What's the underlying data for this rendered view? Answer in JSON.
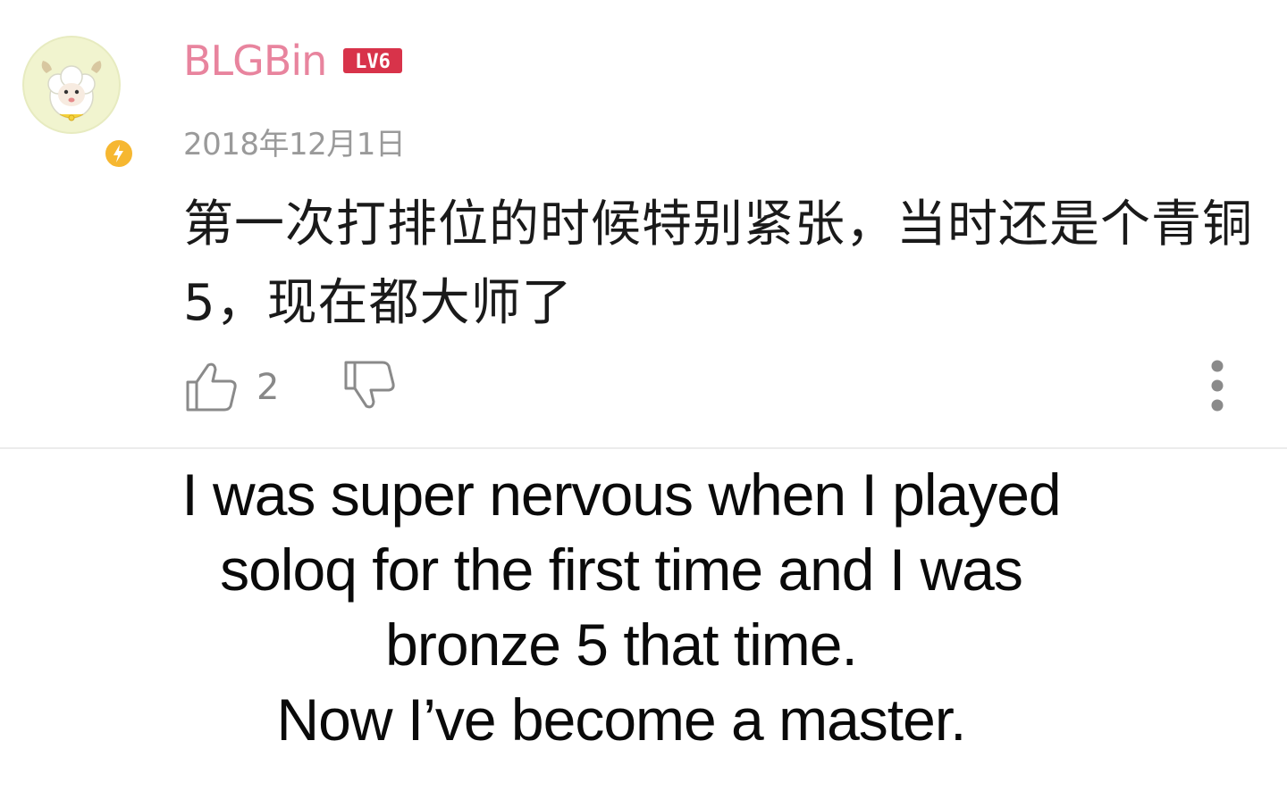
{
  "comment": {
    "username": "BLGBin",
    "level_badge": "LV6",
    "date": "2018年12月1日",
    "content": "第一次打排位的时候特别紧张，当时还是个青铜5，现在都大师了",
    "likes": "2",
    "colors": {
      "username": "#e8849e",
      "level_badge": "#d8334a",
      "avatar_badge": "#f6b731",
      "meta": "#9a9a9a"
    },
    "icons": {
      "like": "thumbs-up-icon",
      "dislike": "thumbs-down-icon",
      "more": "more-vertical-icon",
      "avatar_badge": "lightning-icon"
    }
  },
  "caption": {
    "lines": [
      "I was super nervous when I played",
      "soloq for the first time and I was",
      "bronze 5 that time.",
      "Now I’ve become a master."
    ]
  }
}
